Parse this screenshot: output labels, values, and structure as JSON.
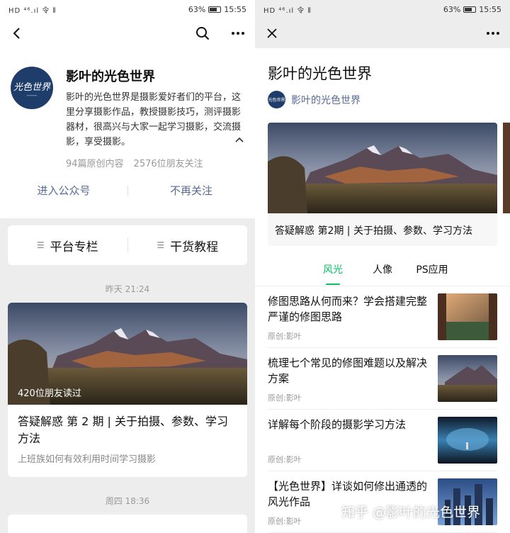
{
  "status_left": {
    "signal": "HD ⁴⁶.ıl 令 ⦀",
    "battery_pct": "63%",
    "time": "15:55"
  },
  "status_right": {
    "signal": "HD ⁴⁶.ıl 令 ⦀",
    "battery_pct": "63%",
    "time": "15:55"
  },
  "profile": {
    "logo_text": "光色世界",
    "name": "影叶的光色世界",
    "description": "影叶的光色世界是摄影爱好者们的平台，这里分享摄影作品，教授摄影技巧，测评摄影器材，很高兴与大家一起学习摄影，交流摄影，享受摄影。",
    "original_count": "94篇原创内容",
    "followers": "2576位朋友关注",
    "enter_label": "进入公众号",
    "unfollow_label": "不再关注"
  },
  "menu": {
    "item1": "平台专栏",
    "item2": "干货教程"
  },
  "feed": {
    "date1": "昨天 21:24",
    "card1": {
      "reads": "420位朋友读过",
      "title": "答疑解惑 第 2 期 | 关于拍摄、参数、学习方法",
      "subtitle": "上班族如何有效利用时间学习摄影"
    },
    "date2": "周四 18:36"
  },
  "right": {
    "title": "影叶的光色世界",
    "account_logo": "光色世界",
    "account_name": "影叶的光色世界",
    "featured_title": "答疑解惑 第2期 | 关于拍摄、参数、学习方法",
    "tabs": [
      "风光",
      "人像",
      "PS应用"
    ],
    "articles": [
      {
        "title": "修图思路从何而来？学会搭建完整严谨的修图思路",
        "source": "原创:影叶"
      },
      {
        "title": "梳理七个常见的修图难题以及解决方案",
        "source": "原创:影叶"
      },
      {
        "title": "详解每个阶段的摄影学习方法",
        "source": "原创:影叶"
      },
      {
        "title": "【光色世界】详谈如何修出通透的风光作品",
        "source": "原创:影叶"
      }
    ],
    "watermark": "知乎 @影叶的光色世界"
  },
  "colors": {
    "link": "#576b95",
    "accent": "#07c160",
    "avatar": "#1f3d6b"
  }
}
